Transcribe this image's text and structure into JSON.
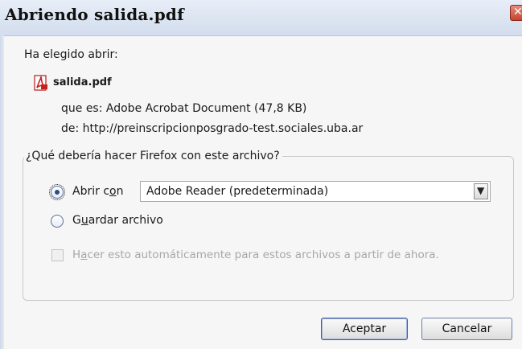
{
  "window": {
    "title": "Abriendo salida.pdf"
  },
  "intro": {
    "label": "Ha elegido abrir:",
    "file_name": "salida.pdf",
    "file_type_line": "que es:  Adobe Acrobat Document (47,8 KB)",
    "from_line": "de:  http://preinscripcionposgrado-test.sociales.uba.ar",
    "file_icon": "pdf-file-icon"
  },
  "action_group": {
    "legend": "¿Qué debería hacer Firefox con este archivo?",
    "open_with": {
      "label_prefix": "Abrir c",
      "label_accel": "o",
      "label_suffix": "n",
      "selected": true
    },
    "app_select": {
      "value": "Adobe Reader  (predeterminada)"
    },
    "save_file": {
      "label_prefix": "G",
      "label_accel": "u",
      "label_suffix": "ardar archivo",
      "selected": false
    },
    "auto_checkbox": {
      "label_prefix": "H",
      "label_accel": "a",
      "label_suffix": "cer esto automáticamente para estos archivos a partir de ahora.",
      "checked": false,
      "enabled": false
    }
  },
  "buttons": {
    "ok_label": "Aceptar",
    "cancel_label": "Cancelar"
  },
  "colors": {
    "titlebar": "#dce4f1",
    "accent": "#2d4a84",
    "disabled_text": "#a7a7a7"
  }
}
